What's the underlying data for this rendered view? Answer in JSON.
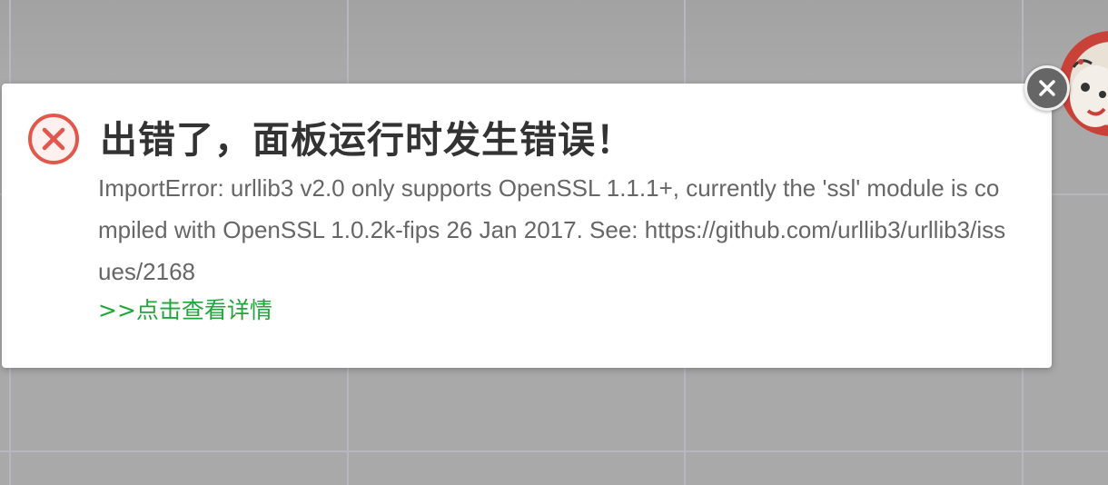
{
  "dialog": {
    "title": "出错了，面板运行时发生错误！",
    "message": "ImportError: urllib3 v2.0 only supports OpenSSL 1.1.1+, currently the 'ssl' module is compiled with OpenSSL 1.0.2k-fips 26 Jan 2017. See: https://github.com/urllib3/urllib3/issues/2168",
    "detail_link": ">>点击查看详情",
    "icon": "error-circle-icon",
    "close_icon": "close-icon"
  },
  "colors": {
    "error_red": "#e2574c",
    "link_green": "#20a53a",
    "title_text": "#333333",
    "message_text": "#666666",
    "backdrop": "#a9a9a9"
  }
}
